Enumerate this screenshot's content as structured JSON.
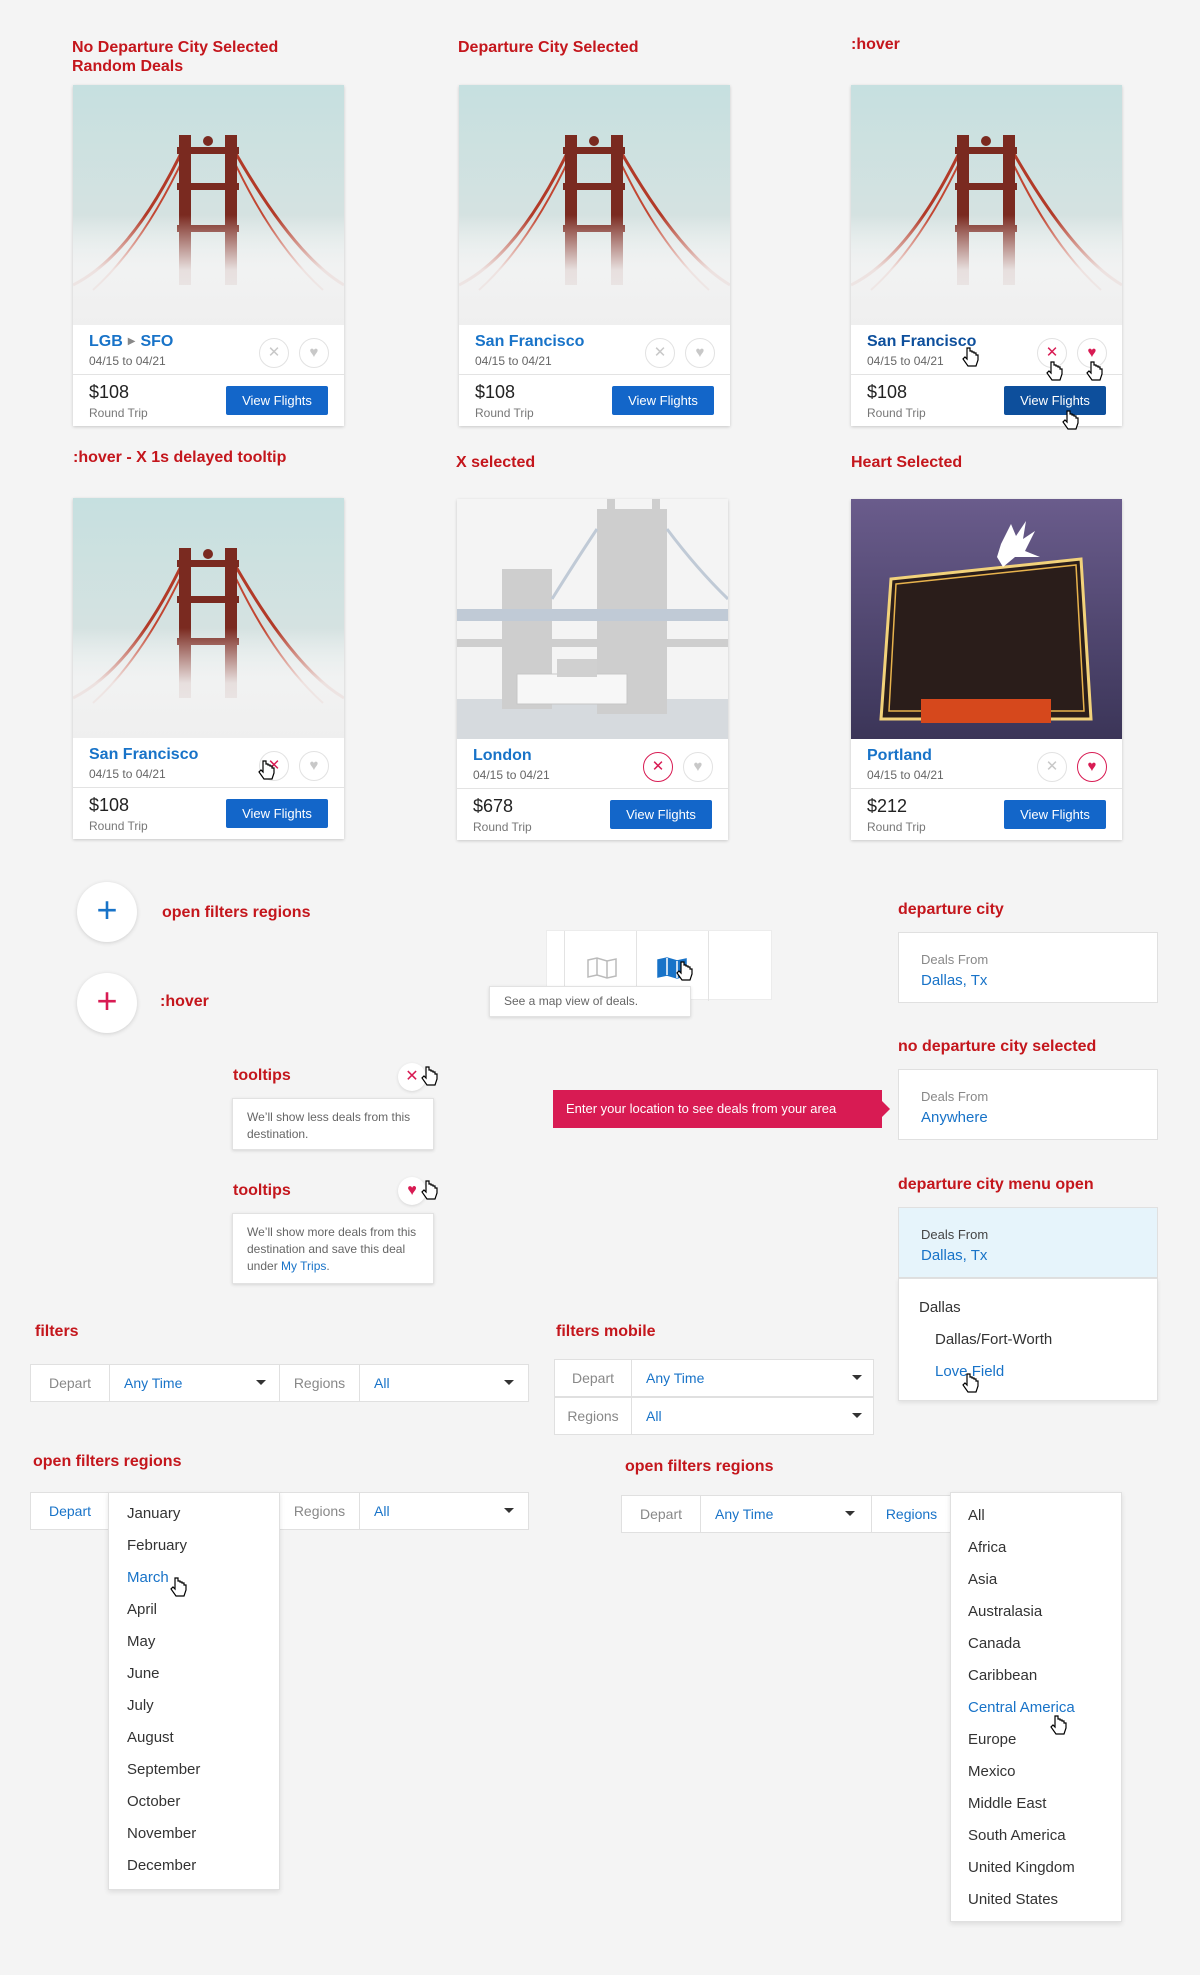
{
  "labels": {
    "no_departure_l1": "No Departure City Selected",
    "no_departure_l2": "Random Deals",
    "departure_selected": "Departure City Selected",
    "hover": ":hover",
    "hover_tooltip": ":hover -  X 1s delayed tooltip",
    "x_selected": "X selected",
    "heart_selected": "Heart Selected",
    "open_filters_regions": "open filters regions",
    "hover2": ":hover",
    "tooltips1": "tooltips",
    "tooltips2": "tooltips",
    "departure_city": "departure city",
    "no_departure_city_selected": "no departure city selected",
    "departure_city_menu_open": "departure city menu open",
    "filters": "filters",
    "filters_mobile": "filters mobile",
    "open_filters_regions_2": "open filters regions",
    "open_filters_regions_3": "open filters regions"
  },
  "cards": [
    {
      "from": "LGB",
      "to": "SFO",
      "city": "",
      "dates": "04/15 to 04/21",
      "price": "$108",
      "trip": "Round Trip",
      "button": "View Flights",
      "photo": "golden-gate"
    },
    {
      "city": "San Francisco",
      "dates": "04/15 to 04/21",
      "price": "$108",
      "trip": "Round Trip",
      "button": "View Flights",
      "photo": "golden-gate"
    },
    {
      "city": "San Francisco",
      "dates": "04/15 to 04/21",
      "price": "$108",
      "trip": "Round Trip",
      "button": "View Flights",
      "photo": "golden-gate"
    },
    {
      "city": "San Francisco",
      "dates": "04/15 to 04/21",
      "price": "$108",
      "trip": "Round Trip",
      "button": "View Flights",
      "photo": "golden-gate"
    },
    {
      "city": "London",
      "dates": "04/15 to 04/21",
      "price": "$678",
      "trip": "Round Trip",
      "button": "View Flights",
      "photo": "tower-bridge"
    },
    {
      "city": "Portland",
      "dates": "04/15 to 04/21",
      "price": "$212",
      "trip": "Round Trip",
      "button": "View Flights",
      "photo": "portland-sign"
    }
  ],
  "icons": {
    "close": "✕",
    "heart": "♥",
    "plus": "+",
    "colors": {
      "blue": "#1873c8",
      "pink": "#d81b53",
      "red_label": "#c4161c"
    }
  },
  "map_tooltip": "See a map view of deals.",
  "tooltip_x": "We’ll show less deals from this destination.",
  "tooltip_heart_text": "We’ll show more deals from this destination and save this deal under",
  "tooltip_heart_link": "My Trips",
  "tooltip_heart_end": ".",
  "location_prompt": "Enter your location to see deals from your area",
  "deals_from": {
    "label": "Deals From",
    "selected": "Dallas, Tx",
    "anywhere": "Anywhere",
    "open_label": "Deals From",
    "open_value": "Dallas, Tx",
    "menu": [
      "Dallas",
      "Dallas/Fort-Worth",
      "Love Field"
    ]
  },
  "filters": {
    "depart_label": "Depart",
    "depart_value": "Any Time",
    "regions_label": "Regions",
    "regions_value": "All"
  },
  "months": [
    "January",
    "February",
    "March",
    "April",
    "May",
    "June",
    "July",
    "August",
    "September",
    "October",
    "November",
    "December"
  ],
  "regions": [
    "All",
    "Africa",
    "Asia",
    "Australasia",
    "Canada",
    "Caribbean",
    "Central America",
    "Europe",
    "Mexico",
    "Middle East",
    "South America",
    "United Kingdom",
    "United States"
  ]
}
